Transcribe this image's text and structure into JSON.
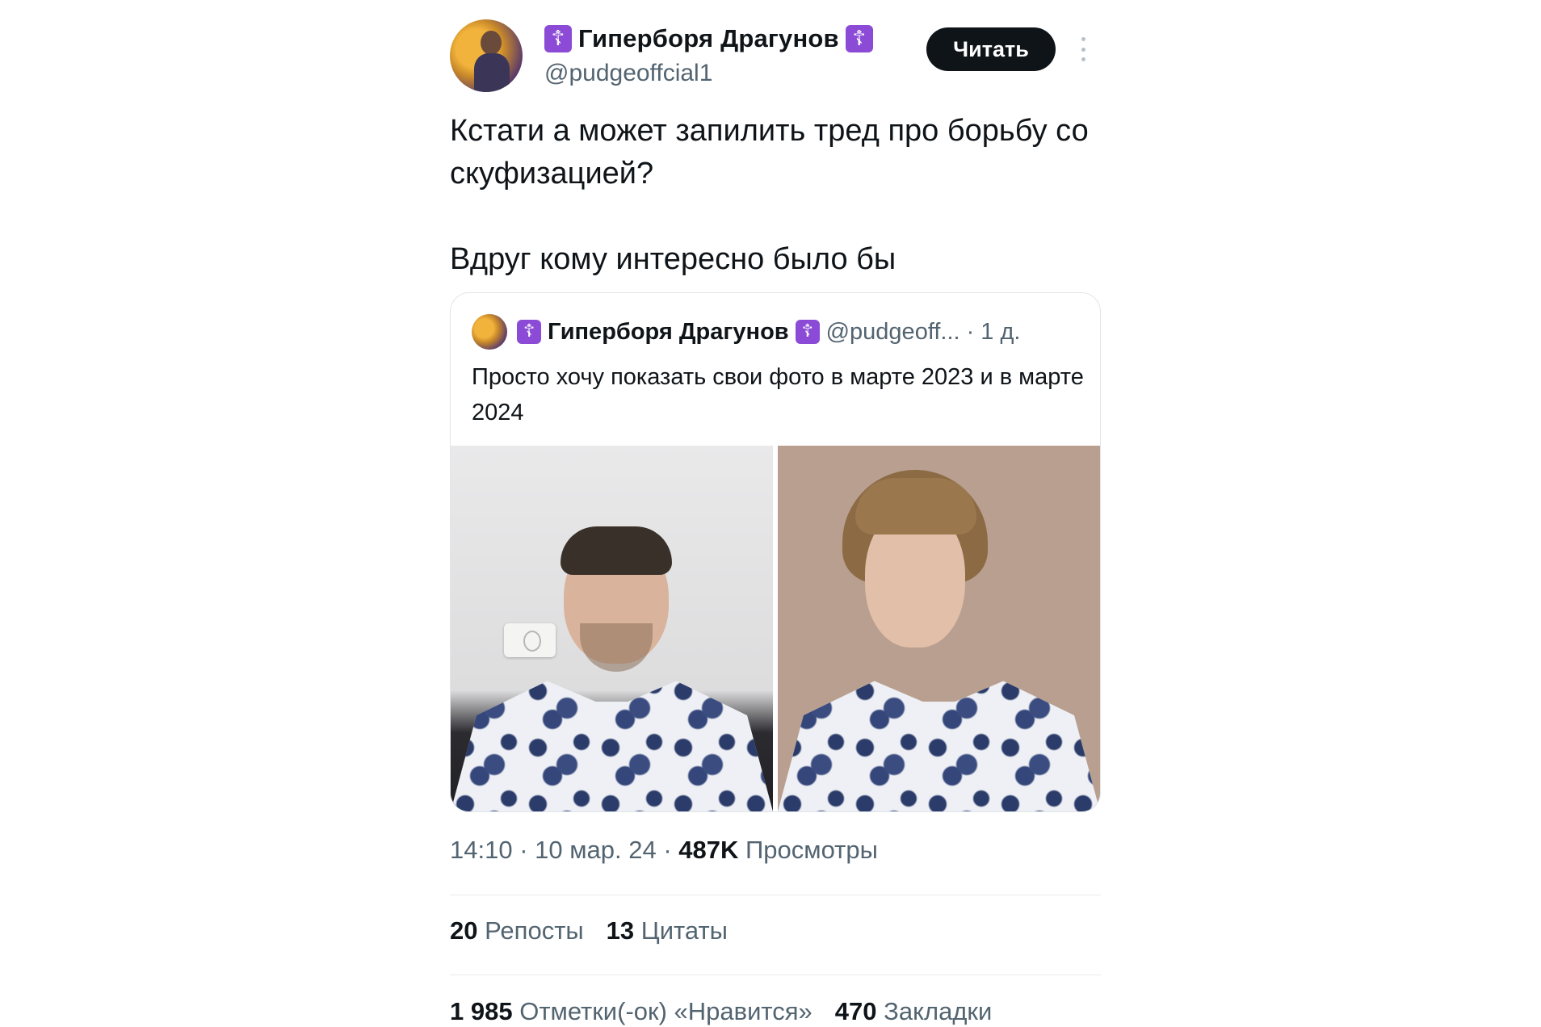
{
  "author": {
    "name": "Гиперборя Драгунов",
    "handle": "@pudgeoffcial1",
    "badge_glyph": "☦",
    "badge_color": "#8c4bd6"
  },
  "follow_button": {
    "label": "Читать"
  },
  "tweet": {
    "paragraph1": "Кстати а может запилить тред про борьбу со скуфизацией?",
    "paragraph2": "Вдруг кому интересно было бы"
  },
  "quoted_tweet": {
    "name": "Гиперборя Драгунов",
    "handle": "@pudgeoff...",
    "separator": "·",
    "time": "1 д.",
    "text": "Просто хочу показать свои фото в марте 2023 и в марте 2024"
  },
  "meta": {
    "time_date": "14:10 · 10 мар. 24 · ",
    "views_count": "487K",
    "views_label": "Просмотры"
  },
  "stats_row1": [
    {
      "count": "20",
      "label": "Репосты"
    },
    {
      "count": "13",
      "label": "Цитаты"
    }
  ],
  "stats_row2": [
    {
      "count": "1 985",
      "label": "Отметки(-ок) «Нравится»"
    },
    {
      "count": "470",
      "label": "Закладки"
    }
  ],
  "colors": {
    "text_primary": "#0f1419",
    "text_secondary": "#536471",
    "button_bg": "#0f1419"
  }
}
